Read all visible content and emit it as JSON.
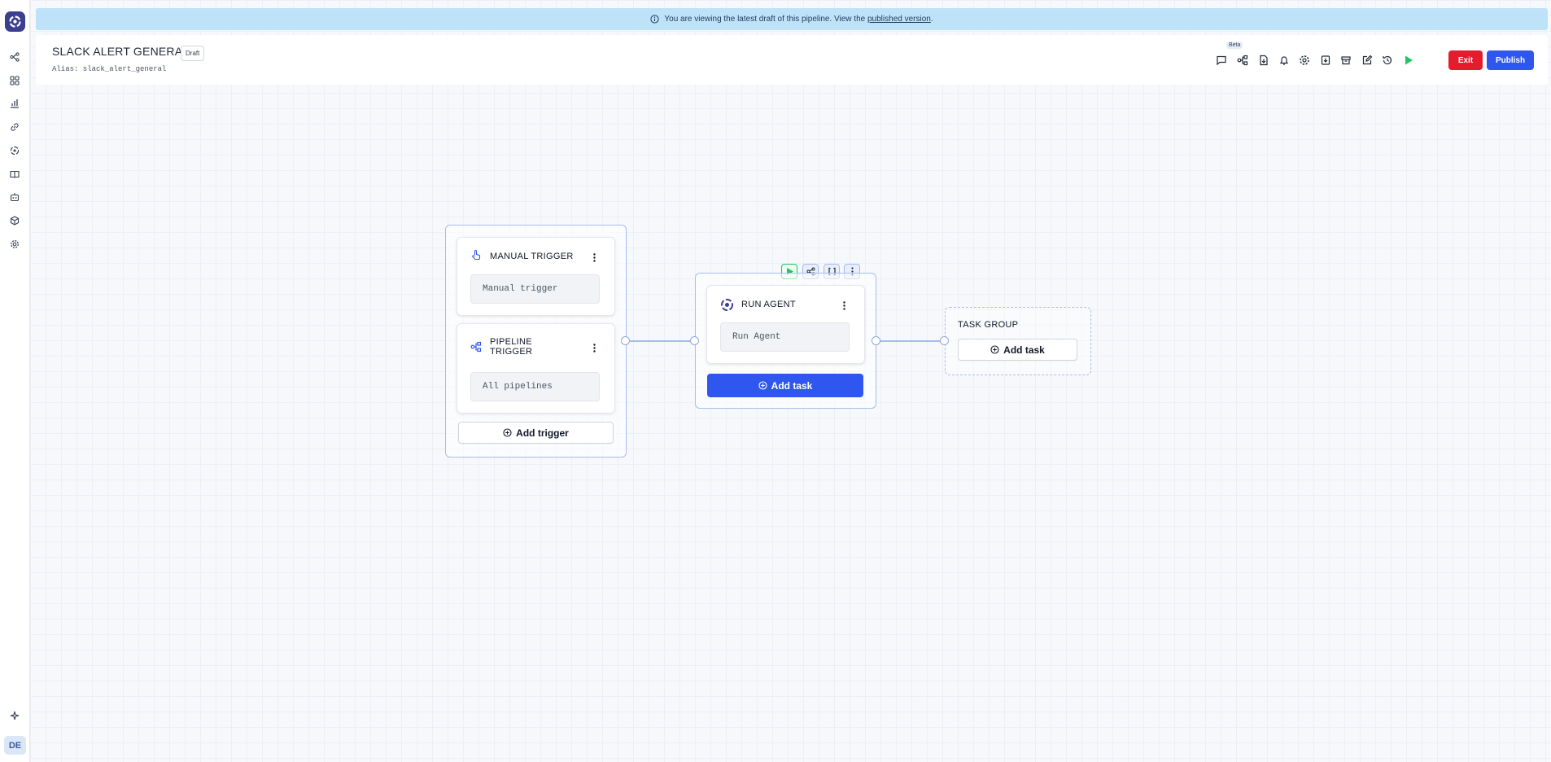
{
  "banner": {
    "text": "You are viewing the latest draft of this pipeline. View the",
    "link": "published version",
    "suffix": "."
  },
  "header": {
    "title": "SLACK ALERT GENERAL",
    "badge": "Draft",
    "alias": "Alias: slack_alert_general",
    "beta_label": "Beta",
    "exit_label": "Exit",
    "publish_label": "Publish"
  },
  "sidebar": {
    "avatar": "DE",
    "items": [
      "pipelines",
      "dashboard",
      "analytics",
      "connections",
      "agents",
      "docs",
      "bots",
      "packages",
      "settings"
    ]
  },
  "trigger_group": {
    "manual": {
      "title": "MANUAL TRIGGER",
      "value": "Manual trigger"
    },
    "pipeline": {
      "title_line1": "PIPELINE",
      "title_line2": "TRIGGER",
      "value": "All pipelines"
    },
    "add_label": "Add trigger"
  },
  "agent_group": {
    "title": "RUN AGENT",
    "value": "Run Agent",
    "add_label": "Add task"
  },
  "task_group": {
    "title": "TASK GROUP",
    "add_label": "Add task"
  },
  "colors": {
    "primary": "#2f57f0",
    "danger": "#e11d2e",
    "banner": "#bee3f8",
    "run": "#22c55e"
  }
}
